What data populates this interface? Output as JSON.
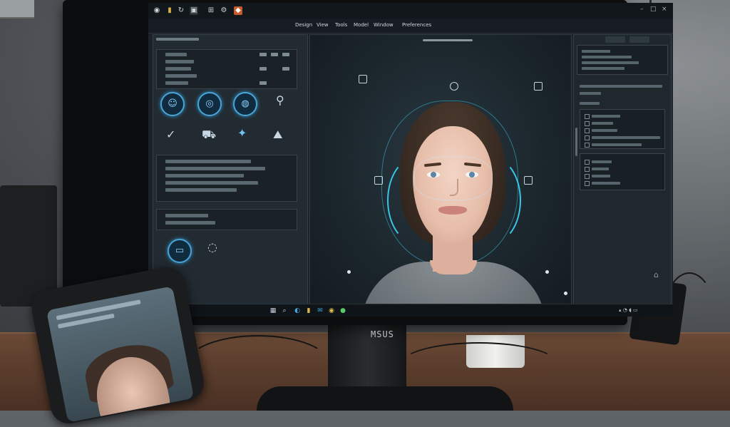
{
  "monitor": {
    "brand": "MSUS"
  },
  "app": {
    "menus": [
      {
        "label": "Design"
      },
      {
        "label": "View"
      },
      {
        "label": "Tools"
      },
      {
        "label": "Model"
      },
      {
        "label": "Window"
      },
      {
        "label": "Preferences"
      }
    ],
    "icons": [
      "home-icon",
      "folder-icon",
      "refresh-icon",
      "camera-icon",
      "grid-icon",
      "settings-icon",
      "app-icon"
    ]
  },
  "colors": {
    "accent": "#4aa3d6",
    "panel": "#222b31",
    "viewport": "#1a252b"
  },
  "left_panel": {
    "tools": [
      {
        "icon": "face-scan-icon"
      },
      {
        "icon": "mesh-icon"
      },
      {
        "icon": "head-icon"
      },
      {
        "icon": "pin-icon"
      },
      {
        "icon": "check-icon"
      },
      {
        "icon": "car-icon"
      },
      {
        "icon": "sparkle-icon"
      },
      {
        "icon": "landmark-icon"
      }
    ],
    "bottom_tools": [
      {
        "icon": "monitor-scan-icon"
      },
      {
        "icon": "capture-icon"
      }
    ]
  },
  "viewport": {
    "subject": "portrait-model"
  },
  "taskbar": {
    "icons": [
      "start-icon",
      "search-icon",
      "edge-icon",
      "folder-icon",
      "mail-icon",
      "chrome-icon",
      "store-icon"
    ]
  }
}
